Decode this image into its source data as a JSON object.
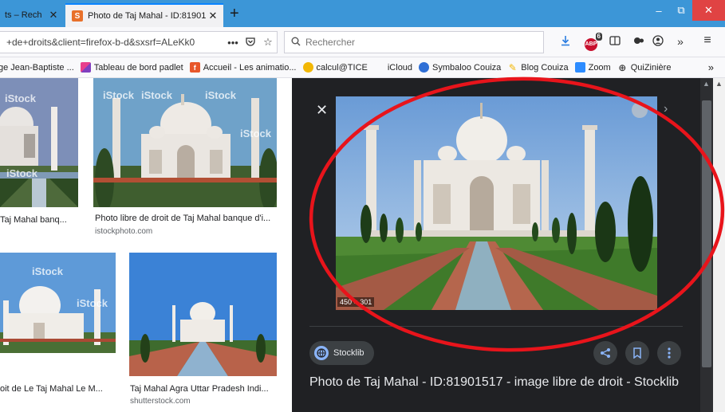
{
  "browser": {
    "tabs": [
      {
        "label": "ts – Rech"
      },
      {
        "label": "Photo de Taj Mahal - ID:81901"
      }
    ],
    "new_tab": "+",
    "window": {
      "minimize": "–",
      "maximize": "⧉",
      "close": "✕"
    },
    "url": "+de+droits&client=firefox-b-d&sxsrf=ALeKk0",
    "search_placeholder": "Rechercher",
    "abp_badge": "6",
    "overflow": "»",
    "menu": "≡"
  },
  "bookmarks": [
    {
      "label": "ge Jean-Baptiste ...",
      "color": ""
    },
    {
      "label": "Tableau de bord padlet",
      "color": "#e83e8c"
    },
    {
      "label": "Accueil - Les animatio...",
      "color": "#e8572a"
    },
    {
      "label": "calcul@TICE",
      "color": "#f2b705"
    },
    {
      "label": "iCloud",
      "color": "#777777"
    },
    {
      "label": "Symbaloo Couiza",
      "color": "#2f6fd6"
    },
    {
      "label": "Blog Couiza",
      "color": "#f2b705"
    },
    {
      "label": "Zoom",
      "color": "#2d8cff"
    },
    {
      "label": "QuiZinière",
      "color": "#444444"
    }
  ],
  "results": [
    {
      "title": "Taj Mahal banq...",
      "source": "",
      "watermark": "iStock"
    },
    {
      "title": "Photo libre de droit de Taj Mahal banque d'i...",
      "source": "istockphoto.com",
      "watermark": "iStock"
    },
    {
      "title": "oit de Le Taj Mahal Le M...",
      "source": "",
      "watermark": "iStock"
    },
    {
      "title": "Taj Mahal Agra Uttar Pradesh Indi...",
      "source": "shutterstock.com",
      "watermark": ""
    }
  ],
  "preview": {
    "close": "✕",
    "next": "›",
    "size": "450 × 301",
    "source": "Stocklib",
    "title": "Photo de Taj Mahal - ID:81901517 - image libre de droit - Stocklib",
    "actions": {
      "share": "share",
      "save": "save",
      "more": "more"
    }
  },
  "colors": {
    "accent": "#3c96d7",
    "panel_bg": "#202124",
    "annotation": "#e8141b"
  }
}
